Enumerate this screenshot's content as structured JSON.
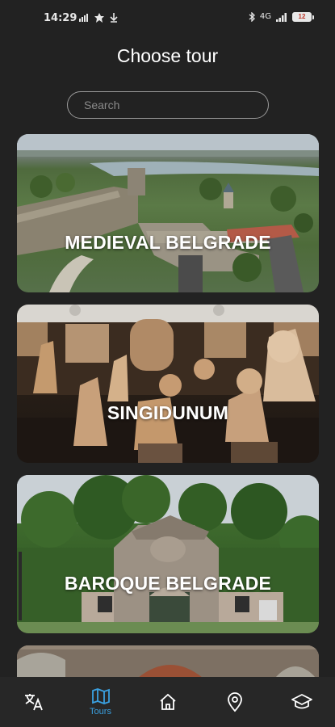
{
  "status_bar": {
    "time": "14:29",
    "network": "4G",
    "battery": "12"
  },
  "page": {
    "title": "Choose tour"
  },
  "search": {
    "placeholder": "Search"
  },
  "tours": [
    {
      "label": "MEDIEVAL BELGRADE"
    },
    {
      "label": "SINGIDUNUM"
    },
    {
      "label": "BAROQUE BELGRADE"
    }
  ],
  "bottom_nav": {
    "active_color": "#3aa0e0",
    "items": [
      {
        "icon": "translate-icon"
      },
      {
        "icon": "map-icon",
        "label": "Tours"
      },
      {
        "icon": "home-icon"
      },
      {
        "icon": "location-pin-icon"
      },
      {
        "icon": "graduation-cap-icon"
      }
    ]
  }
}
